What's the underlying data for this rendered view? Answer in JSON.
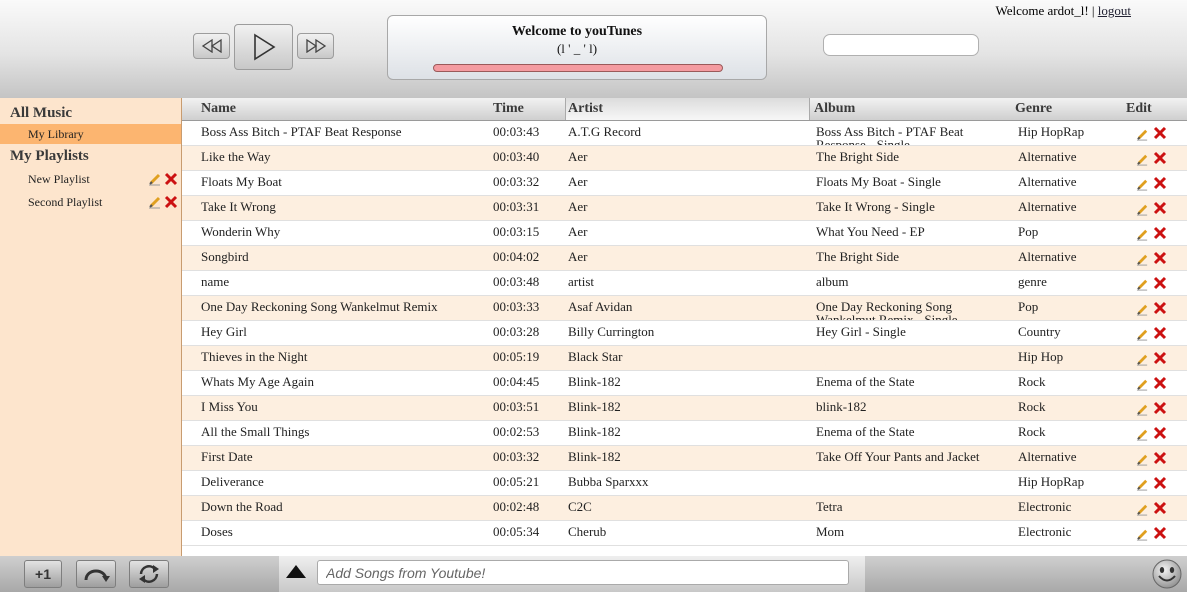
{
  "header": {
    "now_playing_title": "Welcome to youTunes",
    "now_playing_sub": "(l ' _ ' l)",
    "progress": 1.0,
    "search_value": "",
    "welcome_text": "Welcome ardot_l! |",
    "logout_label": "logout"
  },
  "sidebar": {
    "all_music_heading": "All Music",
    "library_item": "My Library",
    "playlists_heading": "My Playlists",
    "playlists": [
      {
        "label": "New Playlist"
      },
      {
        "label": "Second Playlist"
      }
    ]
  },
  "table": {
    "columns": [
      "Name",
      "Time",
      "Artist",
      "Album",
      "Genre",
      "Edit"
    ],
    "rows": [
      {
        "name": "Boss Ass Bitch - PTAF Beat Response",
        "time": "00:03:43",
        "artist": "A.T.G Record",
        "album": "Boss Ass Bitch - PTAF Beat Response - Single",
        "genre": "Hip HopRap"
      },
      {
        "name": "Like the Way",
        "time": "00:03:40",
        "artist": "Aer",
        "album": "The Bright Side",
        "genre": "Alternative"
      },
      {
        "name": "Floats My Boat",
        "time": "00:03:32",
        "artist": "Aer",
        "album": "Floats My Boat - Single",
        "genre": "Alternative"
      },
      {
        "name": "Take It Wrong",
        "time": "00:03:31",
        "artist": "Aer",
        "album": "Take It Wrong - Single",
        "genre": "Alternative"
      },
      {
        "name": "Wonderin Why",
        "time": "00:03:15",
        "artist": "Aer",
        "album": "What You Need - EP",
        "genre": "Pop"
      },
      {
        "name": "Songbird",
        "time": "00:04:02",
        "artist": "Aer",
        "album": "The Bright Side",
        "genre": "Alternative"
      },
      {
        "name": "name",
        "time": "00:03:48",
        "artist": "artist",
        "album": "album",
        "genre": "genre"
      },
      {
        "name": "One Day Reckoning Song Wankelmut Remix",
        "time": "00:03:33",
        "artist": "Asaf Avidan",
        "album": "One Day Reckoning Song Wankelmut Remix - Single",
        "genre": "Pop"
      },
      {
        "name": "Hey Girl",
        "time": "00:03:28",
        "artist": "Billy Currington",
        "album": "Hey Girl - Single",
        "genre": "Country"
      },
      {
        "name": "Thieves in the Night",
        "time": "00:05:19",
        "artist": "Black Star",
        "album": "",
        "genre": "Hip Hop"
      },
      {
        "name": "Whats My Age Again",
        "time": "00:04:45",
        "artist": "Blink-182",
        "album": "Enema of the State",
        "genre": "Rock"
      },
      {
        "name": "I Miss You",
        "time": "00:03:51",
        "artist": "Blink-182",
        "album": "blink-182",
        "genre": "Rock"
      },
      {
        "name": "All the Small Things",
        "time": "00:02:53",
        "artist": "Blink-182",
        "album": "Enema of the State",
        "genre": "Rock"
      },
      {
        "name": "First Date",
        "time": "00:03:32",
        "artist": "Blink-182",
        "album": "Take Off Your Pants and Jacket",
        "genre": "Alternative"
      },
      {
        "name": "Deliverance",
        "time": "00:05:21",
        "artist": "Bubba Sparxxx",
        "album": "",
        "genre": "Hip HopRap"
      },
      {
        "name": "Down the Road",
        "time": "00:02:48",
        "artist": "C2C",
        "album": "Tetra",
        "genre": "Electronic"
      },
      {
        "name": "Doses",
        "time": "00:05:34",
        "artist": "Cherub",
        "album": "Mom",
        "genre": "Electronic"
      }
    ]
  },
  "footer": {
    "plus_one_label": "+1",
    "add_placeholder": "Add Songs from Youtube!"
  },
  "colors": {
    "accent": "#fcb570",
    "row_alt": "#fdefe0",
    "sidebar_bg": "#fde5cd",
    "progress": "#f49ba0",
    "delete": "#cc1111"
  }
}
